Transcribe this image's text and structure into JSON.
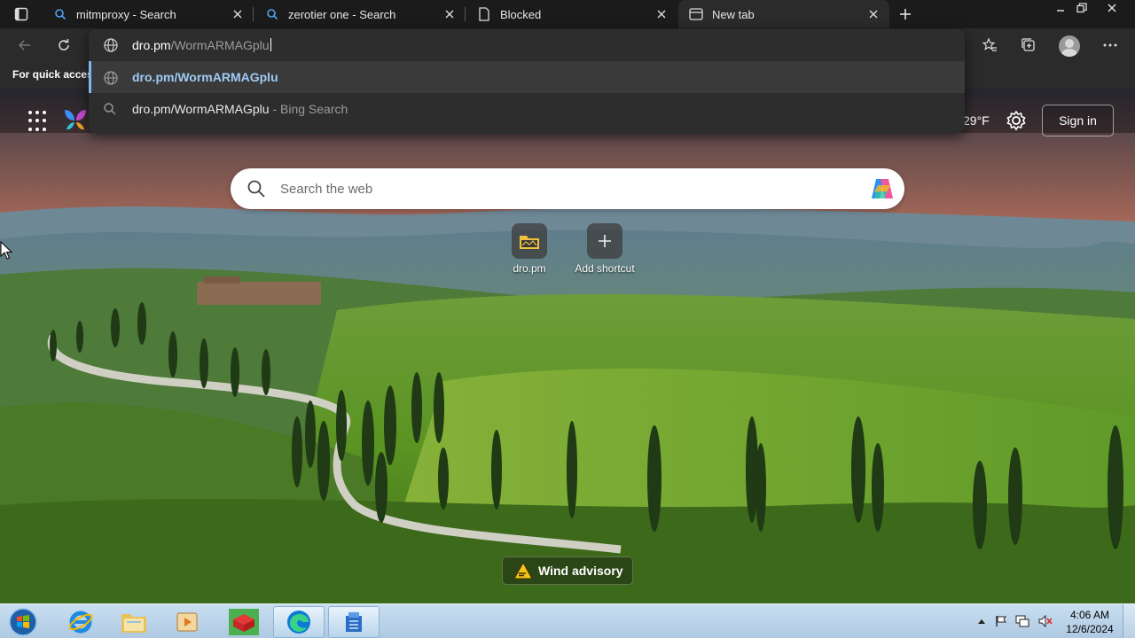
{
  "tabs": [
    {
      "title": "mitmproxy - Search",
      "icon": "search-icon"
    },
    {
      "title": "zerotier one - Search",
      "icon": "search-icon"
    },
    {
      "title": "Blocked",
      "icon": "document-icon"
    },
    {
      "title": "New tab",
      "icon": "new-tab-icon",
      "active": true
    }
  ],
  "favorites_bar": {
    "text": "For quick access"
  },
  "omnibox": {
    "host": "dro.pm",
    "path": "/WormARMAGplu",
    "suggestions": [
      {
        "text": "dro.pm/WormARMAGplu",
        "icon": "globe-icon",
        "selected": true
      },
      {
        "text": "dro.pm/WormARMAGplu",
        "suffix": " - Bing Search",
        "icon": "search-icon"
      }
    ]
  },
  "ntp": {
    "weather_temp": "29°F",
    "sign_in_label": "Sign in",
    "search_placeholder": "Search the web",
    "shortcuts": [
      {
        "label": "dro.pm",
        "icon": "folder-icon"
      },
      {
        "label": "Add shortcut",
        "icon": "plus-icon"
      }
    ],
    "advisory_label": "Wind advisory"
  },
  "taskbar": {
    "time": "4:06 AM",
    "date": "12/6/2024"
  },
  "colors": {
    "accent_blue": "#7fb8f0",
    "taskbar": "#c9dff1"
  }
}
